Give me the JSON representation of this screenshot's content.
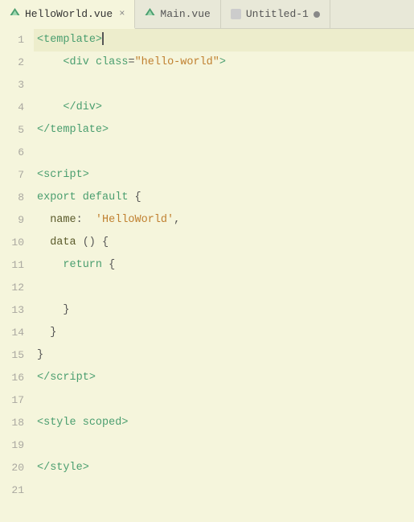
{
  "tabs": [
    {
      "label": "HelloWorld.vue",
      "id": "helloworld",
      "active": true,
      "closable": true,
      "modified": false,
      "icon": "vue-icon"
    },
    {
      "label": "Main.vue",
      "id": "main",
      "active": false,
      "closable": false,
      "modified": false,
      "icon": "vue-icon"
    },
    {
      "label": "Untitled-1",
      "id": "untitled",
      "active": false,
      "closable": false,
      "modified": true,
      "icon": "untitled-icon"
    }
  ],
  "lines": [
    {
      "num": 1,
      "tokens": [
        {
          "type": "tag-bracket",
          "text": "<"
        },
        {
          "type": "tag-name",
          "text": "template"
        },
        {
          "type": "tag-bracket",
          "text": ">"
        }
      ],
      "cursor": true
    },
    {
      "num": 2,
      "tokens": [
        {
          "type": "plain",
          "text": "    "
        },
        {
          "type": "tag-bracket",
          "text": "<"
        },
        {
          "type": "tag-name",
          "text": "div"
        },
        {
          "type": "plain",
          "text": " "
        },
        {
          "type": "attr-name",
          "text": "class"
        },
        {
          "type": "punctuation",
          "text": "="
        },
        {
          "type": "attr-value",
          "text": "\"hello-world\""
        },
        {
          "type": "tag-bracket",
          "text": ">"
        }
      ],
      "cursor": false
    },
    {
      "num": 3,
      "tokens": [],
      "cursor": false
    },
    {
      "num": 4,
      "tokens": [
        {
          "type": "plain",
          "text": "    "
        },
        {
          "type": "tag-bracket",
          "text": "</"
        },
        {
          "type": "tag-name",
          "text": "div"
        },
        {
          "type": "tag-bracket",
          "text": ">"
        }
      ],
      "cursor": false
    },
    {
      "num": 5,
      "tokens": [
        {
          "type": "tag-bracket",
          "text": "</"
        },
        {
          "type": "tag-name",
          "text": "template"
        },
        {
          "type": "tag-bracket",
          "text": ">"
        }
      ],
      "cursor": false
    },
    {
      "num": 6,
      "tokens": [],
      "cursor": false
    },
    {
      "num": 7,
      "tokens": [
        {
          "type": "tag-bracket",
          "text": "<"
        },
        {
          "type": "tag-name",
          "text": "script"
        },
        {
          "type": "tag-bracket",
          "text": ">"
        }
      ],
      "cursor": false
    },
    {
      "num": 8,
      "tokens": [
        {
          "type": "keyword-export",
          "text": "export"
        },
        {
          "type": "plain",
          "text": " "
        },
        {
          "type": "keyword-default",
          "text": "default"
        },
        {
          "type": "plain",
          "text": " {"
        }
      ],
      "cursor": false
    },
    {
      "num": 9,
      "tokens": [
        {
          "type": "plain",
          "text": "  "
        },
        {
          "type": "key-name",
          "text": "name"
        },
        {
          "type": "plain",
          "text": ":  "
        },
        {
          "type": "string-value",
          "text": "'HelloWorld'"
        },
        {
          "type": "plain",
          "text": ","
        }
      ],
      "cursor": false
    },
    {
      "num": 10,
      "tokens": [
        {
          "type": "plain",
          "text": "  "
        },
        {
          "type": "key-name",
          "text": "data"
        },
        {
          "type": "plain",
          "text": " () {"
        }
      ],
      "cursor": false
    },
    {
      "num": 11,
      "tokens": [
        {
          "type": "plain",
          "text": "    "
        },
        {
          "type": "keyword-return",
          "text": "return"
        },
        {
          "type": "plain",
          "text": " {"
        }
      ],
      "cursor": false
    },
    {
      "num": 12,
      "tokens": [],
      "cursor": false
    },
    {
      "num": 13,
      "tokens": [
        {
          "type": "plain",
          "text": "    }"
        }
      ],
      "cursor": false
    },
    {
      "num": 14,
      "tokens": [
        {
          "type": "plain",
          "text": "  }"
        }
      ],
      "cursor": false
    },
    {
      "num": 15,
      "tokens": [
        {
          "type": "plain",
          "text": "}"
        }
      ],
      "cursor": false
    },
    {
      "num": 16,
      "tokens": [
        {
          "type": "tag-bracket",
          "text": "</"
        },
        {
          "type": "tag-name",
          "text": "script"
        },
        {
          "type": "tag-bracket",
          "text": ">"
        }
      ],
      "cursor": false
    },
    {
      "num": 17,
      "tokens": [],
      "cursor": false
    },
    {
      "num": 18,
      "tokens": [
        {
          "type": "tag-bracket",
          "text": "<"
        },
        {
          "type": "tag-name",
          "text": "style"
        },
        {
          "type": "plain",
          "text": " "
        },
        {
          "type": "attr-name",
          "text": "scoped"
        },
        {
          "type": "tag-bracket",
          "text": ">"
        }
      ],
      "cursor": false
    },
    {
      "num": 19,
      "tokens": [],
      "cursor": false
    },
    {
      "num": 20,
      "tokens": [
        {
          "type": "tag-bracket",
          "text": "</"
        },
        {
          "type": "tag-name",
          "text": "style"
        },
        {
          "type": "tag-bracket",
          "text": ">"
        }
      ],
      "cursor": false
    },
    {
      "num": 21,
      "tokens": [],
      "cursor": false
    }
  ],
  "colors": {
    "background": "#f5f5dc",
    "tabBarBg": "#e8e8d8",
    "activeTab": "#f5f5dc",
    "vueGreen": "#4a9e6f",
    "lineNumberColor": "#aaa8a0"
  }
}
